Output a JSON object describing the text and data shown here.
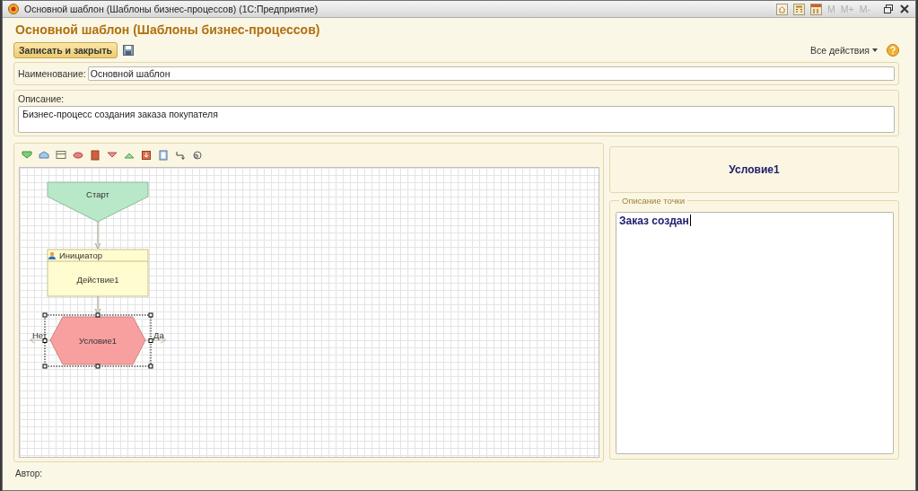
{
  "window": {
    "title": "Основной шаблон (Шаблоны бизнес-процессов)  (1С:Предприятие)",
    "memory_buttons": [
      "M",
      "M+",
      "M-"
    ]
  },
  "form": {
    "title": "Основной шаблон (Шаблоны бизнес-процессов)",
    "save_close": "Записать и закрыть",
    "all_actions": "Все действия"
  },
  "name_field": {
    "label": "Наименование:",
    "value": "Основной шаблон"
  },
  "description_field": {
    "label": "Описание:",
    "value": "Бизнес-процесс создания заказа покупателя"
  },
  "diagram": {
    "nodes": [
      {
        "kind": "start",
        "label": "Старт",
        "selected": false
      },
      {
        "kind": "action",
        "header": "Инициатор",
        "label": "Действие1",
        "selected": false
      },
      {
        "kind": "condition",
        "label": "Условие1",
        "selected": true,
        "no_label": "Нет",
        "yes_label": "Да"
      }
    ]
  },
  "point": {
    "title": "Условие1",
    "group_label": "Описание точки",
    "description": "Заказ создан"
  },
  "author": {
    "label": "Автор:"
  }
}
